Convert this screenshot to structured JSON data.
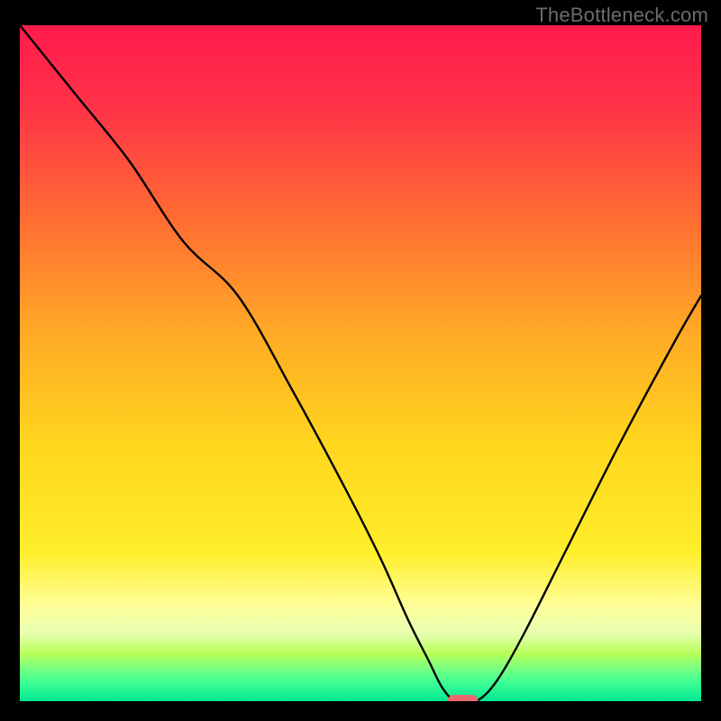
{
  "watermark": {
    "text": "TheBottleneck.com"
  },
  "colors": {
    "background": "#000000",
    "watermark_text": "#6b6b6b",
    "curve_stroke": "#000000",
    "marker": "#e96a6e",
    "top_red": "#ff1a4d",
    "mid_orange1": "#ff6a33",
    "mid_orange2": "#ffb020",
    "yellow": "#ffe720",
    "pale_yellow": "#ffff9a",
    "lime": "#b8ff58",
    "green1": "#58ff92",
    "green2": "#00e893"
  },
  "chart_data": {
    "type": "line",
    "title": "",
    "xlabel": "",
    "ylabel": "",
    "xlim": [
      0,
      100
    ],
    "ylim": [
      0,
      100
    ],
    "x": [
      0,
      8,
      16,
      24,
      32,
      40,
      48,
      53,
      57,
      60,
      62,
      64,
      67,
      70,
      74,
      80,
      88,
      96,
      100
    ],
    "values": [
      100,
      90,
      80,
      68,
      60,
      46,
      31,
      21,
      12,
      6,
      2,
      0,
      0,
      3,
      10,
      22,
      38,
      53,
      60
    ],
    "marker": {
      "x": 65,
      "y": 0,
      "width_pct": 4.5
    },
    "annotations": []
  }
}
